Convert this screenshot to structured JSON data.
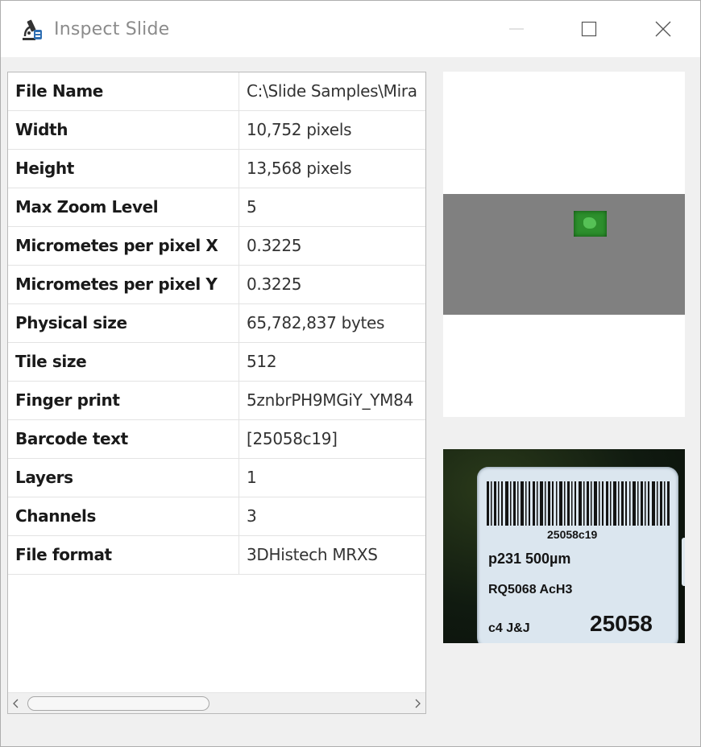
{
  "window": {
    "title": "Inspect Slide",
    "app_icon": "microscope-icon",
    "controls": {
      "minimize_icon": "minimize-icon",
      "maximize_icon": "maximize-icon",
      "close_icon": "close-icon"
    }
  },
  "properties": [
    {
      "key": "File Name",
      "value": "C:\\Slide Samples\\Mira"
    },
    {
      "key": "Width",
      "value": "10,752 pixels"
    },
    {
      "key": "Height",
      "value": "13,568 pixels"
    },
    {
      "key": "Max Zoom Level",
      "value": "5"
    },
    {
      "key": "Micrometes per pixel X",
      "value": "0.3225"
    },
    {
      "key": "Micrometes per pixel Y",
      "value": "0.3225"
    },
    {
      "key": "Physical size",
      "value": "65,782,837 bytes"
    },
    {
      "key": "Tile size",
      "value": "512"
    },
    {
      "key": "Finger print",
      "value": "5znbrPH9MGiY_YM84"
    },
    {
      "key": "Barcode text",
      "value": "[25058c19]"
    },
    {
      "key": "Layers",
      "value": "1"
    },
    {
      "key": "Channels",
      "value": "3"
    },
    {
      "key": "File format",
      "value": "3DHistech MRXS"
    }
  ],
  "scrollbar": {
    "left_icon": "chevron-left-icon",
    "right_icon": "chevron-right-icon"
  },
  "slide_label": {
    "barcode_text": "25058c19",
    "line1": "p231   500µm",
    "line2": "RQ5068  AcH3",
    "line3_left": "c4    J&J",
    "line3_right": "25058"
  },
  "colors": {
    "thumbnail_background": "#808080",
    "tissue": "#2d8f2d"
  }
}
